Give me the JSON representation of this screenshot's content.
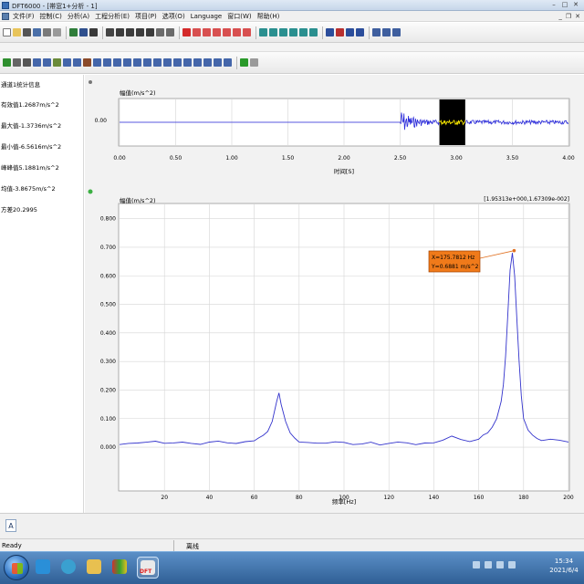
{
  "window": {
    "title": "DFT6000 - [帯窓1+分析 - 1]"
  },
  "menu": [
    "文件(F)",
    "控制(C)",
    "分析(A)",
    "工程分析(E)",
    "项目(P)",
    "选项(O)",
    "Language",
    "窗口(W)",
    "帮助(H)"
  ],
  "stats": {
    "title": "通道1统计信息",
    "rows": [
      {
        "label": "有效值",
        "value": "1.2687m/s^2"
      },
      {
        "label": "最大值",
        "value": "-1.3736m/s^2"
      },
      {
        "label": "最小值",
        "value": "-6.5616m/s^2"
      },
      {
        "label": "峰峰值",
        "value": "5.1881m/s^2"
      },
      {
        "label": "均值",
        "value": "-3.8675m/s^2"
      },
      {
        "label": "方差",
        "value": "20.2995"
      }
    ]
  },
  "time_chart": {
    "ylabel": "幅值(m/s^2)",
    "xlabel": "时间[S]",
    "ytick": "0.00",
    "xticks": [
      "0.00",
      "0.50",
      "1.00",
      "1.50",
      "2.00",
      "2.50",
      "3.00",
      "3.50",
      "4.00"
    ],
    "xlim": [
      0,
      4.0
    ],
    "burst_start": 2.5,
    "selection": [
      2.85,
      3.08
    ],
    "colors": {
      "signal": "#2a2adb",
      "selection_bg": "#000000",
      "selection_signal": "#f0e000"
    }
  },
  "chart_data": {
    "type": "line",
    "title": "",
    "xlabel": "频率[Hz]",
    "ylabel": "幅值(m/s^2)",
    "range_label": "[1.95313e+000,1.67309e-002]",
    "xlim": [
      0,
      200
    ],
    "ylim": [
      -0.15,
      0.85
    ],
    "xticks": [
      "20",
      "40",
      "60",
      "80",
      "100",
      "120",
      "140",
      "160",
      "180",
      "200"
    ],
    "yticks": [
      "0.000",
      "0.100",
      "0.200",
      "0.300",
      "0.400",
      "0.500",
      "0.600",
      "0.700",
      "0.800"
    ],
    "grid": true,
    "series": [
      {
        "color": "#3333cc",
        "x": [
          0,
          4,
          8,
          12,
          16,
          20,
          24,
          28,
          32,
          36,
          40,
          44,
          48,
          52,
          56,
          60,
          62,
          64,
          66,
          68,
          70,
          71,
          72,
          74,
          76,
          78,
          80,
          84,
          88,
          92,
          96,
          100,
          104,
          108,
          112,
          116,
          120,
          124,
          128,
          132,
          136,
          140,
          144,
          148,
          152,
          156,
          160,
          162,
          164,
          166,
          168,
          170,
          171,
          172,
          173,
          174,
          175,
          176,
          177,
          178,
          179,
          180,
          182,
          184,
          186,
          188,
          192,
          196,
          200
        ],
        "y": [
          0.01,
          0.015,
          0.012,
          0.018,
          0.02,
          0.015,
          0.012,
          0.018,
          0.014,
          0.01,
          0.015,
          0.02,
          0.016,
          0.012,
          0.018,
          0.025,
          0.03,
          0.04,
          0.055,
          0.09,
          0.16,
          0.19,
          0.15,
          0.09,
          0.05,
          0.03,
          0.02,
          0.018,
          0.015,
          0.012,
          0.018,
          0.015,
          0.01,
          0.012,
          0.016,
          0.01,
          0.012,
          0.018,
          0.015,
          0.01,
          0.014,
          0.018,
          0.025,
          0.04,
          0.03,
          0.02,
          0.03,
          0.04,
          0.05,
          0.07,
          0.1,
          0.16,
          0.22,
          0.32,
          0.47,
          0.62,
          0.68,
          0.6,
          0.45,
          0.3,
          0.18,
          0.1,
          0.06,
          0.04,
          0.03,
          0.025,
          0.03,
          0.022,
          0.02
        ]
      }
    ],
    "annotation": {
      "x": 175.7812,
      "y": 0.6881,
      "line1": "X=175.7812 Hz",
      "line2": "Y=0.6881 m/s^2"
    }
  },
  "bottom": {
    "mode_button": "A"
  },
  "status": {
    "ready": "Ready",
    "mode": "离线"
  },
  "clock": {
    "time": "15:34",
    "date": "2021/6/4"
  }
}
